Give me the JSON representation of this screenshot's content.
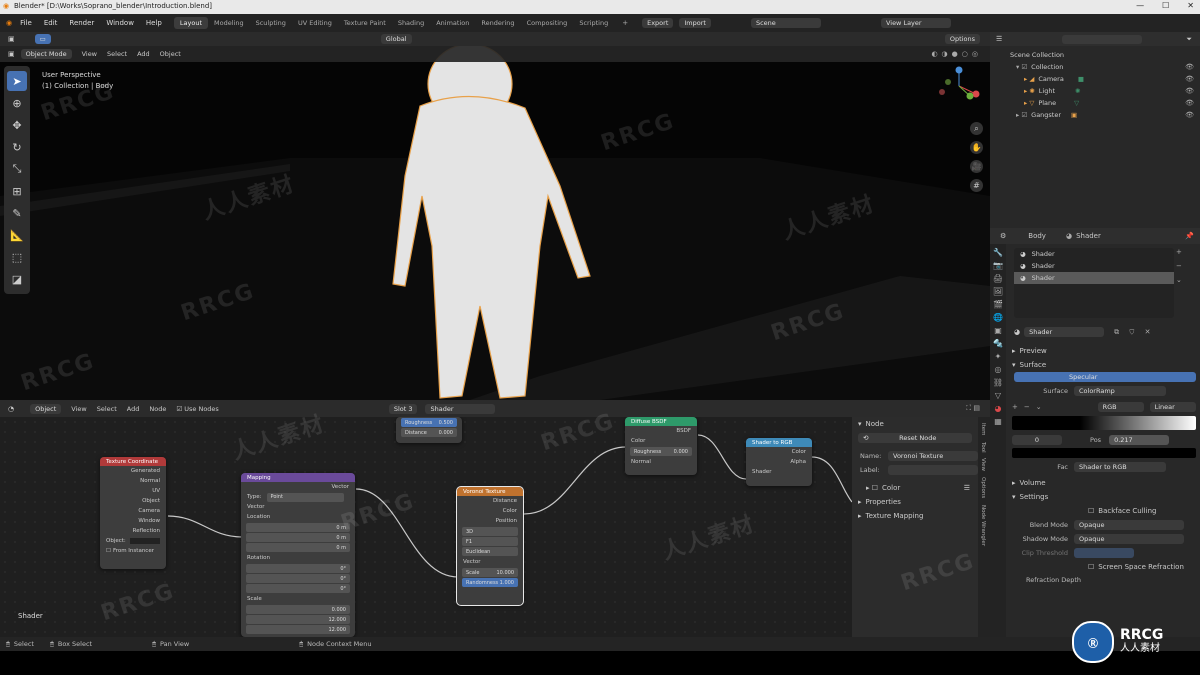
{
  "titlebar": {
    "text": "Blender* [D:\\Works\\Soprano_blender\\Introduction.blend]"
  },
  "menu": [
    "File",
    "Edit",
    "Render",
    "Window",
    "Help"
  ],
  "workspaces": [
    "Layout",
    "Modeling",
    "Sculpting",
    "UV Editing",
    "Texture Paint",
    "Shading",
    "Animation",
    "Rendering",
    "Compositing",
    "Scripting"
  ],
  "topbar": {
    "render_btn1": "Export",
    "render_btn2": "Import",
    "scene": "Scene",
    "view_layer": "View Layer"
  },
  "viewport": {
    "mode": "Object Mode",
    "menus": [
      "View",
      "Select",
      "Add",
      "Object"
    ],
    "transform": "Global",
    "options": "Options",
    "info_line1": "User Perspective",
    "info_line2": "(1) Collection | Body"
  },
  "outliner": {
    "root": "Scene Collection",
    "items": [
      {
        "name": "Collection"
      },
      {
        "name": "Camera"
      },
      {
        "name": "Light"
      },
      {
        "name": "Plane"
      },
      {
        "name": "Gangster"
      }
    ]
  },
  "properties": {
    "object": "Body",
    "material_tab": "Shader",
    "slots": [
      "Shader",
      "Shader",
      "Shader"
    ],
    "material_name": "Shader",
    "sections": {
      "preview": "Preview",
      "surface": "Surface",
      "volume": "Volume",
      "settings": "Settings"
    },
    "surface_shader": "Specular",
    "surface_label": "Surface",
    "surface_value": "ColorRamp",
    "rgb_mode": "RGB",
    "interp": "Linear",
    "pos_label": "Pos",
    "pos_value": "0.217",
    "stop_index": "0",
    "fac_label": "Fac",
    "fac_value": "Shader to RGB",
    "backface": "Backface Culling",
    "blend_mode_label": "Blend Mode",
    "blend_mode": "Opaque",
    "shadow_mode_label": "Shadow Mode",
    "shadow_mode": "Opaque",
    "clip_label": "Clip Threshold",
    "ssr": "Screen Space Refraction",
    "refraction_depth": "Refraction Depth"
  },
  "node_editor": {
    "header_menus": [
      "View",
      "Select",
      "Add",
      "Node"
    ],
    "object": "Object",
    "use_nodes": "Use Nodes",
    "slot": "Slot 3",
    "material": "Shader",
    "canvas_label": "Shader",
    "nodes": {
      "texcoord": {
        "title": "Texture Coordinate",
        "outputs": [
          "Generated",
          "Normal",
          "UV",
          "Object",
          "Camera",
          "Window",
          "Reflection"
        ],
        "object_label": "Object:",
        "from_instancer": "From Instancer"
      },
      "mapping": {
        "title": "Mapping",
        "output": "Vector",
        "type_label": "Type:",
        "type": "Point",
        "input": "Vector",
        "location": "Location",
        "rotation": "Rotation",
        "scale": "Scale",
        "loc": [
          "0 m",
          "0 m",
          "0 m"
        ],
        "rot": [
          "0°",
          "0°",
          "0°"
        ],
        "scl": [
          "0.000",
          "12.000",
          "12.000"
        ]
      },
      "voronoi": {
        "title": "Voronoi Texture",
        "outputs": [
          "Distance",
          "Color",
          "Position"
        ],
        "dim": "3D",
        "feature": "F1",
        "metric": "Euclidean",
        "vector": "Vector",
        "scale_label": "Scale",
        "scale": "10.000",
        "random_label": "Randomness",
        "random": "1.000"
      },
      "top": {
        "roughness": "Roughness",
        "roughness_val": "0.500",
        "distance": "Distance",
        "distance_val": "0.000"
      },
      "diffuse": {
        "title": "Diffuse BSDF",
        "output": "BSDF",
        "inputs": [
          "Color",
          "Roughness",
          "Normal"
        ],
        "rough_val": "0.000"
      },
      "shader_rgb": {
        "title": "Shader to RGB",
        "outputs": [
          "Color",
          "Alpha"
        ],
        "input": "Shader"
      }
    },
    "sidebar": {
      "heading": "Node",
      "reset": "Reset Node",
      "name_label": "Name:",
      "name": "Voronoi Texture",
      "label_label": "Label:",
      "color": "Color",
      "properties": "Properties",
      "texture_mapping": "Texture Mapping"
    },
    "vtabs": [
      "Item",
      "Tool",
      "View",
      "Options",
      "Node Wrangler"
    ]
  },
  "statusbar": {
    "select": "Select",
    "box_select": "Box Select",
    "pan": "Pan View",
    "context": "Node Context Menu"
  },
  "watermark": {
    "latin": "RRCG",
    "cjk": "人人素材"
  }
}
